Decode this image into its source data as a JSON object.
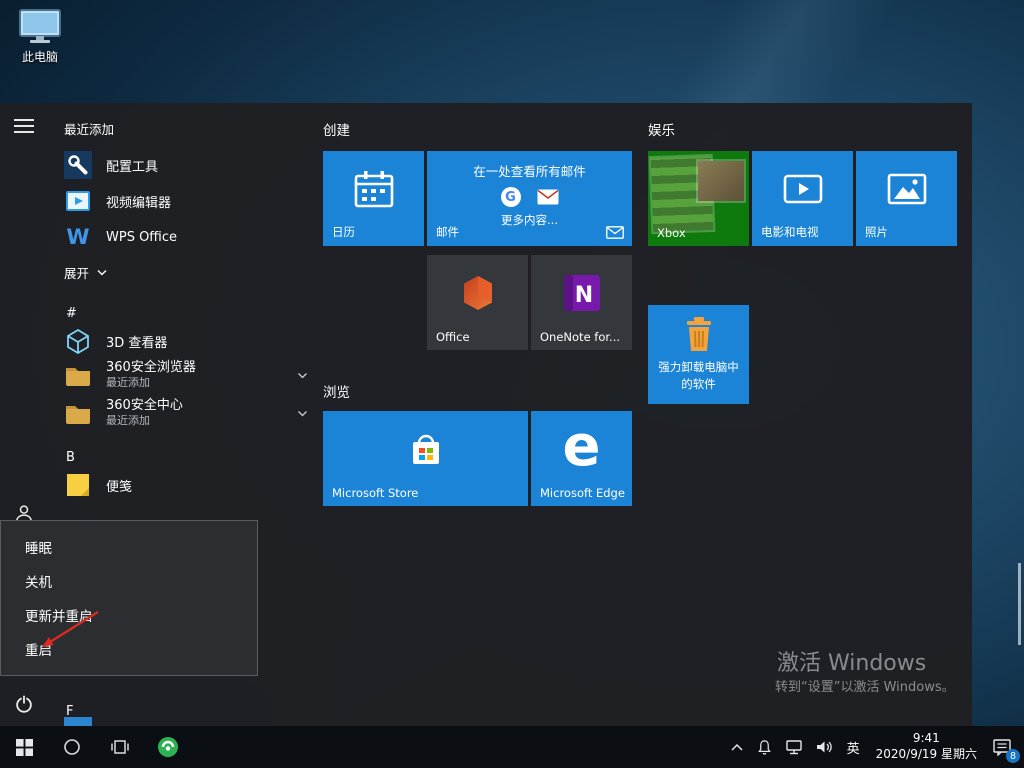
{
  "desktop": {
    "this_pc": "此电脑",
    "watermark_title": "激活 Windows",
    "watermark_sub": "转到“设置”以激活 Windows。"
  },
  "start_menu": {
    "recent_header": "最近添加",
    "apps": {
      "config_tools": "配置工具",
      "video_editor": "视频编辑器",
      "wps_office": "WPS Office",
      "expand": "展开",
      "letter_hash": "#",
      "viewer_3d": "3D 查看器",
      "browser_360": "360安全浏览器",
      "browser_360_sub": "最近添加",
      "center_360": "360安全中心",
      "center_360_sub": "最近添加",
      "letter_b": "B",
      "sticky_notes": "便笺",
      "letter_f": "F"
    },
    "groups": {
      "create": "创建",
      "browse": "浏览",
      "entertainment": "娱乐"
    },
    "tiles": {
      "calendar": "日历",
      "mail": "邮件",
      "mail_headline": "在一处查看所有邮件",
      "mail_more": "更多内容...",
      "office": "Office",
      "onenote": "OneNote for...",
      "store": "Microsoft Store",
      "edge": "Microsoft Edge",
      "xbox": "Xbox",
      "movies": "电影和电视",
      "photos": "照片",
      "uninstaller_line1": "强力卸载电脑中",
      "uninstaller_line2": "的软件"
    },
    "logo_letters": {
      "wps": "W",
      "onenote": "N",
      "edge": "e",
      "google": "G"
    },
    "power_menu": {
      "sleep": "睡眠",
      "shutdown": "关机",
      "update_restart": "更新并重启",
      "restart": "重启"
    }
  },
  "taskbar": {
    "lang": "英",
    "time": "9:41",
    "date": "2020/9/19 星期六",
    "badge": "8"
  },
  "colors": {
    "accent_blue": "#1b84d6",
    "tile_dark": "#34373c",
    "menu_bg": "#202124",
    "taskbar_bg": "#0b0e13",
    "arrow_red": "#d92b1f",
    "xbox_green": "#0e7a0d",
    "folder_yellow": "#d9a94a",
    "onenote_purple": "#7719aa"
  }
}
